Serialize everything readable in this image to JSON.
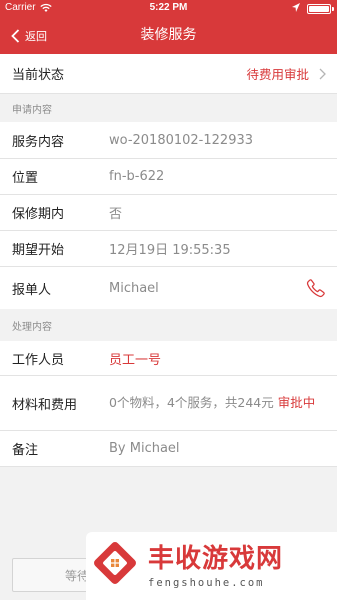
{
  "status_bar": {
    "carrier": "Carrier",
    "time": "5:22 PM"
  },
  "nav": {
    "back_label": "返回",
    "title": "装修服务"
  },
  "current_status": {
    "label": "当前状态",
    "value": "待费用审批"
  },
  "section_apply": "申请内容",
  "apply_rows": [
    {
      "label": "服务内容",
      "value": "wo-20180102-122933"
    },
    {
      "label": "位置",
      "value": "fn-b-622"
    },
    {
      "label": "保修期内",
      "value": "否"
    },
    {
      "label": "期望开始",
      "value": "12月19日 19:55:35"
    },
    {
      "label": "报单人",
      "value": "Michael"
    }
  ],
  "section_process": "处理内容",
  "process_rows": {
    "worker": {
      "label": "工作人员",
      "value": "员工一号"
    },
    "materials": {
      "label": "材料和费用",
      "value": "0个物料，4个服务，共244元 ",
      "status": "审批中"
    },
    "note": {
      "label": "备注",
      "value": "By Michael"
    }
  },
  "bottom_button": "等待",
  "watermark": {
    "name": "丰收游戏网",
    "url": "fengshouhe.com"
  },
  "colors": {
    "accent": "#d8393a",
    "background": "#f2f2f2",
    "muted_text": "#8b8b8b"
  }
}
